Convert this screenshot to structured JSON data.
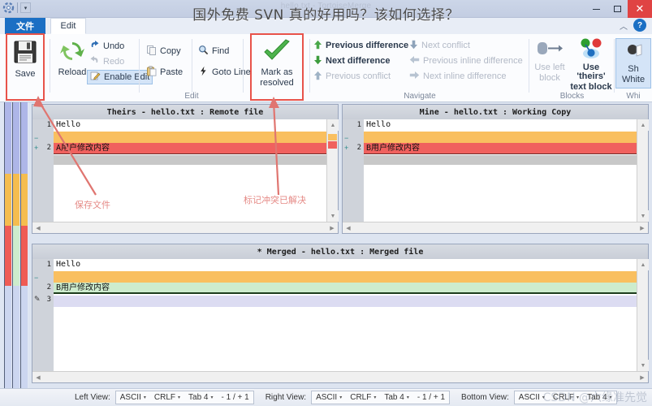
{
  "window": {
    "ghost_title": "hello.txt - TortoiseMerge",
    "overlay_headline": "国外免费 SVN 真的好用吗？该如何选择？",
    "minimize_label": "−",
    "maximize_label": "□",
    "close_label": "✕",
    "help_label": "?",
    "collapse_label": "︿",
    "qat_dropdown": "▾"
  },
  "tabs": [
    {
      "label": "文件",
      "active": true
    },
    {
      "label": "Edit",
      "active": false
    }
  ],
  "ribbon": {
    "groups": [
      {
        "name": "file",
        "label": ""
      },
      {
        "name": "edit",
        "label": "Edit"
      },
      {
        "name": "navigate",
        "label": "Navigate"
      },
      {
        "name": "blocks",
        "label": "Blocks"
      },
      {
        "name": "whitespace",
        "label": "Whi"
      }
    ],
    "save": {
      "label": "Save",
      "icon": "floppy-disk-icon"
    },
    "reload": {
      "label": "Reload",
      "icon": "refresh-icon"
    },
    "undo": {
      "label": "Undo",
      "icon": "undo-arrow-icon",
      "enabled": true
    },
    "redo": {
      "label": "Redo",
      "icon": "redo-arrow-icon",
      "enabled": false
    },
    "enable_edit": {
      "label": "Enable Edit",
      "icon": "pencil-edit-icon",
      "selected": true
    },
    "copy": {
      "label": "Copy",
      "icon": "copy-icon"
    },
    "paste": {
      "label": "Paste",
      "icon": "paste-icon"
    },
    "find": {
      "label": "Find",
      "icon": "magnifier-icon"
    },
    "goto_line": {
      "label": "Goto Line",
      "icon": "lightning-icon"
    },
    "mark_as_resolved": {
      "label_line1": "Mark as",
      "label_line2": "resolved",
      "icon": "green-check-icon"
    },
    "previous_difference": {
      "label": "Previous difference",
      "icon": "up-arrow-green-icon",
      "enabled": true
    },
    "next_difference": {
      "label": "Next difference",
      "icon": "down-arrow-green-icon",
      "enabled": true
    },
    "previous_conflict": {
      "label": "Previous conflict",
      "icon": "up-arrow-icon",
      "enabled": false
    },
    "next_conflict": {
      "label": "Next conflict",
      "icon": "down-arrow-icon",
      "enabled": false
    },
    "previous_inline_difference": {
      "label": "Previous inline difference",
      "icon": "left-arrow-icon",
      "enabled": false
    },
    "next_inline_difference": {
      "label": "Next inline difference",
      "icon": "right-arrow-icon",
      "enabled": false
    },
    "use_left_block": {
      "label_line1": "Use left",
      "label_line2": "block",
      "icon": "use-left-block-icon",
      "dropdown": "▾",
      "enabled": false
    },
    "use_theirs_text_block": {
      "label_line1": "Use 'theirs'",
      "label_line2": "text block",
      "icon": "merge-blocks-icon",
      "dropdown": "▾",
      "enabled": true
    },
    "show_whitespaces": {
      "label_line1": "Sh",
      "label_line2": "White",
      "icon": "whitespace-icon",
      "selected": true
    }
  },
  "panes": {
    "left": {
      "title": "Theirs - hello.txt : Remote file",
      "lines": [
        {
          "no": "1",
          "text": "Hello",
          "marker": "",
          "style": "normal"
        },
        {
          "no": "",
          "text": "",
          "marker": "−",
          "style": "empty-orange"
        },
        {
          "no": "2",
          "text": "A用户修改内容",
          "marker": "+",
          "style": "conflict-red"
        }
      ]
    },
    "right": {
      "title": "Mine - hello.txt : Working Copy",
      "lines": [
        {
          "no": "1",
          "text": "Hello",
          "marker": "",
          "style": "normal"
        },
        {
          "no": "",
          "text": "",
          "marker": "−",
          "style": "empty-orange"
        },
        {
          "no": "2",
          "text": "B用户修改内容",
          "marker": "+",
          "style": "conflict-red"
        }
      ]
    },
    "merged": {
      "title": "* Merged - hello.txt : Merged file",
      "lines": [
        {
          "no": "1",
          "text": "Hello",
          "marker": "",
          "style": "normal"
        },
        {
          "no": "",
          "text": "",
          "marker": "−",
          "style": "empty-orange"
        },
        {
          "no": "2",
          "text": "B用户修改内容",
          "marker": "",
          "style": "resolved-green"
        },
        {
          "no": "3",
          "text": "",
          "marker": "✎",
          "style": "edited-lavender"
        }
      ]
    }
  },
  "statusbar": {
    "left_view": {
      "label": "Left View:",
      "encoding": "ASCII",
      "eol": "CRLF",
      "tab": "Tab 4",
      "counts": "- 1 / + 1"
    },
    "right_view": {
      "label": "Right View:",
      "encoding": "ASCII",
      "eol": "CRLF",
      "tab": "Tab 4",
      "counts": "- 1 / + 1"
    },
    "bottom_view": {
      "label": "Bottom View:",
      "encoding": "ASCII",
      "eol": "CRLF",
      "tab": "Tab 4",
      "counts": ""
    },
    "caret": "▾"
  },
  "annotations": [
    {
      "text": "保存文件",
      "name": "annotation-save-file"
    },
    {
      "text": "标记冲突已解决",
      "name": "annotation-mark-resolved"
    }
  ],
  "watermark": "CSDN @六缘准先觉",
  "colors": {
    "accent_blue": "#1b6fc4",
    "conflict_red": "#f0615e",
    "empty_orange": "#f9bf5f",
    "resolved_green": "#cdeccd",
    "edited_lavender": "#dcdcf2",
    "annotation_red": "#e58a86",
    "close_red": "#e04343",
    "redbox": "#e8534a"
  }
}
